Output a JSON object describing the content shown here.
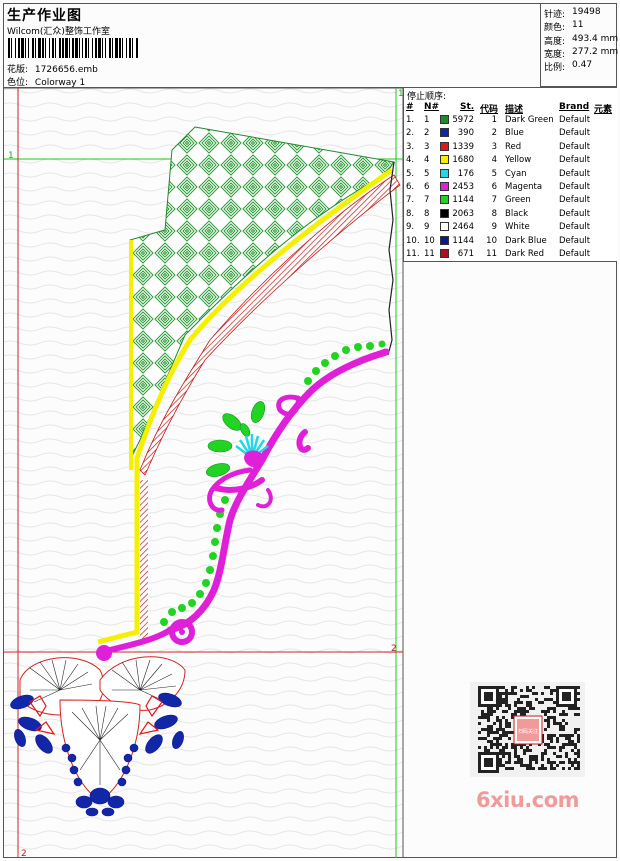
{
  "header": {
    "title": "生产作业图",
    "software": "Wilcom(汇众)整饰工作室",
    "design_label": "花版:",
    "design_file": "1726656.emb",
    "color_label": "色位:",
    "colorway": "Colorway 1"
  },
  "stats": [
    {
      "label": "针迹:",
      "value": "19498"
    },
    {
      "label": "颜色:",
      "value": "11"
    },
    {
      "label": "高度:",
      "value": "493.4 mm"
    },
    {
      "label": "宽度:",
      "value": "277.2 mm"
    },
    {
      "label": "比例:",
      "value": "0.47"
    }
  ],
  "legend": {
    "title": "停止顺序:",
    "headers": [
      "#",
      "N#",
      "St.",
      "代码",
      "描述",
      "Brand",
      "元素"
    ],
    "rows": [
      {
        "idx": "1.",
        "n": "1",
        "st": "5972",
        "code": "1",
        "desc": "Dark Green",
        "brand": "Default",
        "color": "#1e8a2c"
      },
      {
        "idx": "2.",
        "n": "2",
        "st": "390",
        "code": "2",
        "desc": "Blue",
        "brand": "Default",
        "color": "#1226a8"
      },
      {
        "idx": "3.",
        "n": "3",
        "st": "1339",
        "code": "3",
        "desc": "Red",
        "brand": "Default",
        "color": "#e01818"
      },
      {
        "idx": "4.",
        "n": "4",
        "st": "1680",
        "code": "4",
        "desc": "Yellow",
        "brand": "Default",
        "color": "#f4f000"
      },
      {
        "idx": "5.",
        "n": "5",
        "st": "176",
        "code": "5",
        "desc": "Cyan",
        "brand": "Default",
        "color": "#22d8e8"
      },
      {
        "idx": "6.",
        "n": "6",
        "st": "2453",
        "code": "6",
        "desc": "Magenta",
        "brand": "Default",
        "color": "#e020d8"
      },
      {
        "idx": "7.",
        "n": "7",
        "st": "1144",
        "code": "7",
        "desc": "Green",
        "brand": "Default",
        "color": "#22d422"
      },
      {
        "idx": "8.",
        "n": "8",
        "st": "2063",
        "code": "8",
        "desc": "Black",
        "brand": "Default",
        "color": "#000000"
      },
      {
        "idx": "9.",
        "n": "9",
        "st": "2464",
        "code": "9",
        "desc": "White",
        "brand": "Default",
        "color": "#ffffff"
      },
      {
        "idx": "10.",
        "n": "10",
        "st": "1144",
        "code": "10",
        "desc": "Dark Blue",
        "brand": "Default",
        "color": "#0c1a8c"
      },
      {
        "idx": "11.",
        "n": "11",
        "st": "671",
        "code": "11",
        "desc": "Dark Red",
        "brand": "Default",
        "color": "#b0101a"
      }
    ]
  },
  "guides": {
    "label_1": "1",
    "label_2": "2"
  },
  "watermark": {
    "text": "6xiu.com",
    "qr_caption": "扫码关注"
  }
}
